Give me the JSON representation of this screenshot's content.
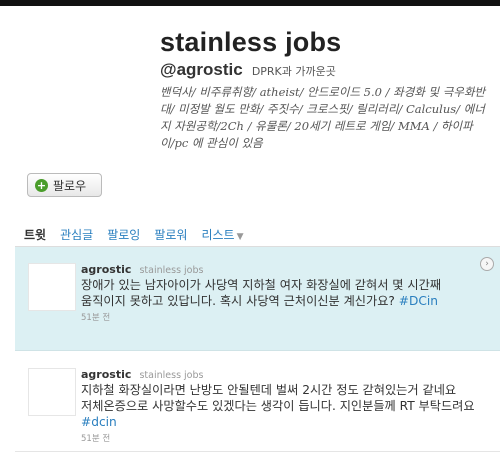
{
  "profile": {
    "name": "stainless jobs",
    "handle": "@agrostic",
    "real_name": "DPRK과 가까운곳",
    "bio": "밴덕사/ 비주류취향/ atheist/ 안드로이드 5.0 / 좌경화 및 극우화반대/ 미정발 월도 만화/ 주짓수/ 크로스핏/ 릴리러리/ Calculus/ 에너지 자원공학/2Ch / 유물론/ 20세기 레트로 게임/ MMA / 하이파이/pc 에 관심이 있음"
  },
  "follow_button": {
    "label": "팔로우"
  },
  "tabs": [
    {
      "label": "트윗",
      "active": true
    },
    {
      "label": "관심글"
    },
    {
      "label": "팔로잉"
    },
    {
      "label": "팔로워"
    },
    {
      "label": "리스트"
    }
  ],
  "tweets": [
    {
      "author": "agrostic",
      "fullname": "stainless jobs",
      "text": "장애가 있는 남자아이가 사당역 지하철 여자 화장실에 갇혀서 몇 시간째 움직이지 못하고 있답니다. 혹시 사당역 근처이신분 계신가요? ",
      "hashtag": "#DCin",
      "time": "51분 전"
    },
    {
      "author": "agrostic",
      "fullname": "stainless jobs",
      "text": "지하철 화장실이라면 난방도 안될텐데 벌써 2시간 정도 갇혀있는거 같네요 저체온증으로 사망할수도 있겠다는 생각이 듭니다. 지인분들께 RT 부탁드려요 ",
      "hashtag": "#dcin",
      "time": "51분 전"
    }
  ],
  "colors": {
    "link": "#2a7fbf",
    "highlight_bg": "#dcf0f3",
    "plus_icon": "#4a9d2b"
  }
}
